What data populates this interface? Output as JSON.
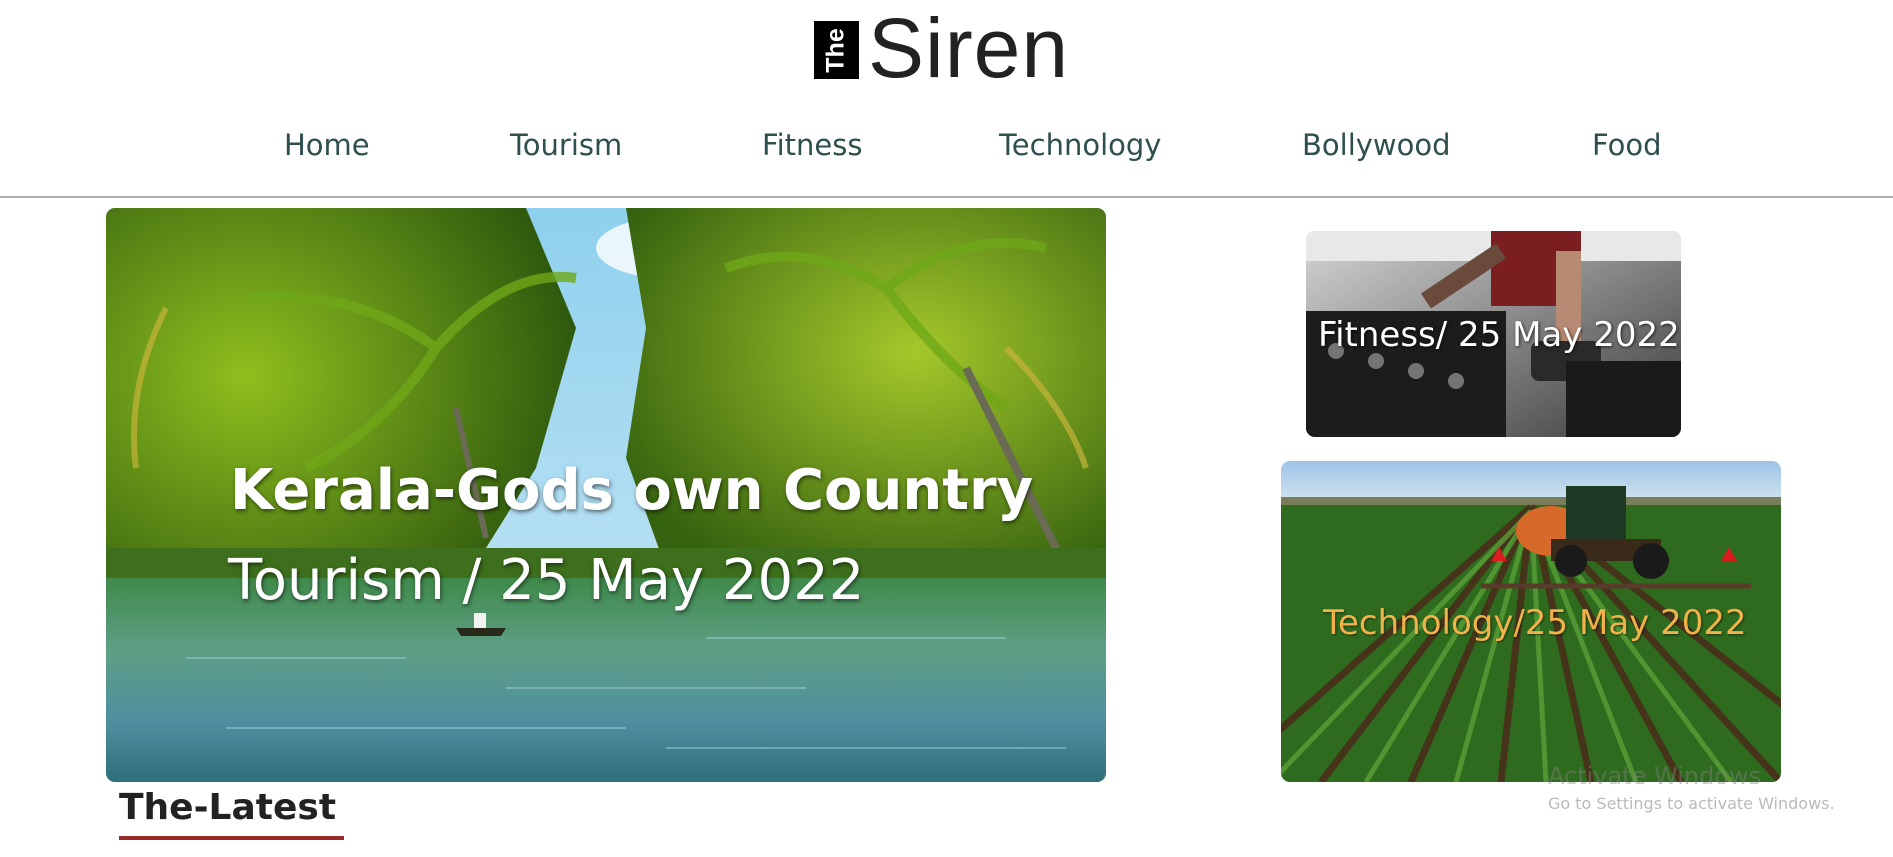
{
  "logo": {
    "box_text": "The",
    "name": "Siren"
  },
  "nav": {
    "items": [
      {
        "label": "Home"
      },
      {
        "label": "Tourism"
      },
      {
        "label": "Fitness"
      },
      {
        "label": "Technology"
      },
      {
        "label": "Bollywood"
      },
      {
        "label": "Food"
      }
    ]
  },
  "hero": {
    "title": "Kerala-Gods own Country",
    "meta": "Tourism / 25 May 2022"
  },
  "side_cards": [
    {
      "label": "Fitness/ 25 May 2022"
    },
    {
      "label": "Technology/25 May 2022"
    }
  ],
  "section": {
    "heading": "The-Latest"
  },
  "watermark": {
    "title": "Activate Windows",
    "subtitle": "Go to Settings to activate Windows."
  },
  "colors": {
    "nav_text": "#2f4f4f",
    "underline": "#9a2a2a",
    "tech_label": "#f2b24a"
  }
}
